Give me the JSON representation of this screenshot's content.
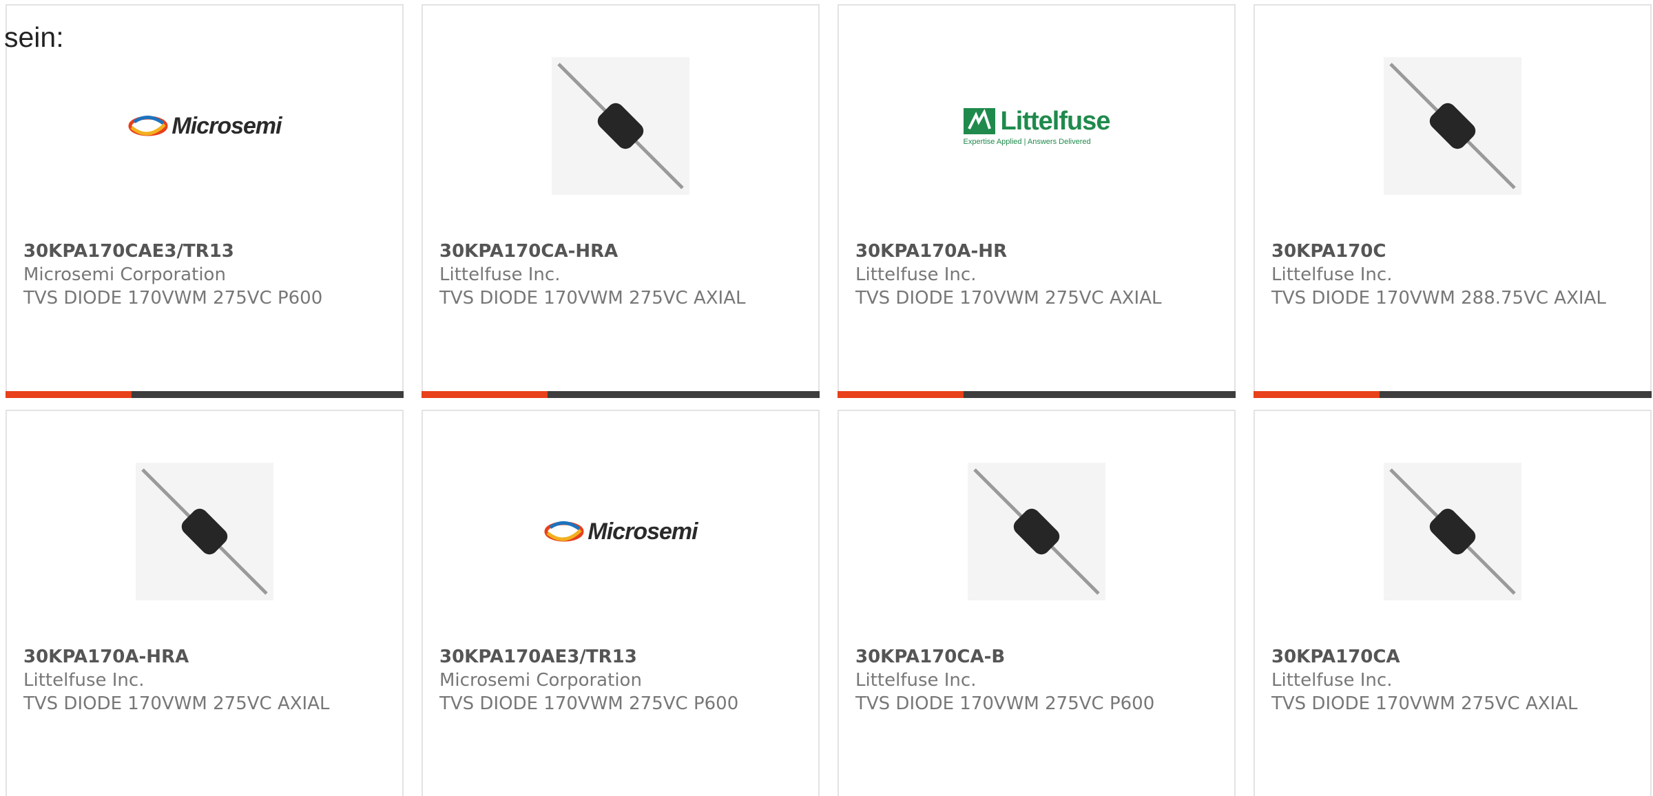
{
  "intro_text": "sein:",
  "colors": {
    "accent": "#e8401a",
    "bar": "#3d3d3d",
    "border": "#e3e3e3",
    "littelfuse_green": "#1f8a4c"
  },
  "cards": [
    {
      "part_number": "30KPA170CAE3/TR13",
      "manufacturer": "Microsemi Corporation",
      "description": "TVS DIODE 170VWM 275VC P600",
      "image": "microsemi-logo",
      "logo_text": "Microsemi"
    },
    {
      "part_number": "30KPA170CA-HRA",
      "manufacturer": "Littelfuse Inc.",
      "description": "TVS DIODE 170VWM 275VC AXIAL",
      "image": "axial-diode-photo",
      "logo_text": ""
    },
    {
      "part_number": "30KPA170A-HR",
      "manufacturer": "Littelfuse Inc.",
      "description": "TVS DIODE 170VWM 275VC AXIAL",
      "image": "littelfuse-logo",
      "logo_text": "Littelfuse",
      "logo_tagline": "Expertise Applied | Answers Delivered"
    },
    {
      "part_number": "30KPA170C",
      "manufacturer": "Littelfuse Inc.",
      "description": "TVS DIODE 170VWM 288.75VC AXIAL",
      "image": "axial-diode-photo",
      "logo_text": ""
    },
    {
      "part_number": "30KPA170A-HRA",
      "manufacturer": "Littelfuse Inc.",
      "description": "TVS DIODE 170VWM 275VC AXIAL",
      "image": "axial-diode-photo",
      "logo_text": ""
    },
    {
      "part_number": "30KPA170AE3/TR13",
      "manufacturer": "Microsemi Corporation",
      "description": "TVS DIODE 170VWM 275VC P600",
      "image": "microsemi-logo",
      "logo_text": "Microsemi"
    },
    {
      "part_number": "30KPA170CA-B",
      "manufacturer": "Littelfuse Inc.",
      "description": "TVS DIODE 170VWM 275VC P600",
      "image": "axial-diode-photo",
      "logo_text": ""
    },
    {
      "part_number": "30KPA170CA",
      "manufacturer": "Littelfuse Inc.",
      "description": "TVS DIODE 170VWM 275VC AXIAL",
      "image": "axial-diode-photo",
      "logo_text": ""
    }
  ]
}
